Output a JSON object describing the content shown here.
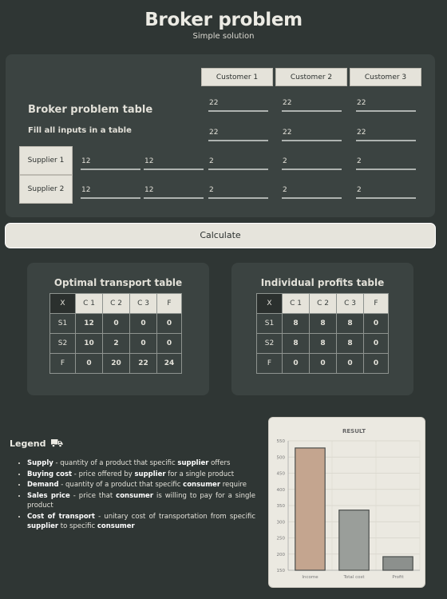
{
  "header": {
    "title": "Broker problem",
    "subtitle": "Simple solution"
  },
  "input": {
    "title": "Broker problem table",
    "hint": "Fill all inputs in a table",
    "customers": [
      "Customer 1",
      "Customer 2",
      "Customer 3"
    ],
    "demand": [
      "22",
      "22",
      "22"
    ],
    "sales_price": [
      "22",
      "22",
      "22"
    ],
    "suppliers": [
      {
        "label": "Supplier 1",
        "supply": "12",
        "cost": "12",
        "transport": [
          "2",
          "2",
          "2"
        ]
      },
      {
        "label": "Supplier 2",
        "supply": "12",
        "cost": "12",
        "transport": [
          "2",
          "2",
          "2"
        ]
      }
    ]
  },
  "calculate_label": "Calculate",
  "transport_table": {
    "title": "Optimal transport table",
    "headers": [
      "X",
      "C 1",
      "C 2",
      "C 3",
      "F"
    ],
    "rows": [
      {
        "label": "S1",
        "values": [
          "12",
          "0",
          "0",
          "0"
        ]
      },
      {
        "label": "S2",
        "values": [
          "10",
          "2",
          "0",
          "0"
        ]
      },
      {
        "label": "F",
        "values": [
          "0",
          "20",
          "22",
          "24"
        ]
      }
    ]
  },
  "profits_table": {
    "title": "Individual profits table",
    "headers": [
      "X",
      "C 1",
      "C 2",
      "C 3",
      "F"
    ],
    "rows": [
      {
        "label": "S1",
        "values": [
          "8",
          "8",
          "8",
          "0"
        ]
      },
      {
        "label": "S2",
        "values": [
          "8",
          "8",
          "8",
          "0"
        ]
      },
      {
        "label": "F",
        "values": [
          "0",
          "0",
          "0",
          "0"
        ]
      }
    ]
  },
  "legend": {
    "title": "Legend",
    "icon": "truck-icon",
    "items": [
      [
        {
          "t": "Supply",
          "b": true
        },
        {
          "t": " - quantity of a product that specific "
        },
        {
          "t": "supplier",
          "b": true
        },
        {
          "t": " offers"
        }
      ],
      [
        {
          "t": "Buying cost",
          "b": true
        },
        {
          "t": " - price offered by "
        },
        {
          "t": "supplier",
          "b": true
        },
        {
          "t": " for a single product"
        }
      ],
      [
        {
          "t": "Demand",
          "b": true
        },
        {
          "t": " - quantity of a product that specific "
        },
        {
          "t": "consumer",
          "b": true
        },
        {
          "t": " require"
        }
      ],
      [
        {
          "t": "Sales price",
          "b": true
        },
        {
          "t": " - price that "
        },
        {
          "t": "consumer",
          "b": true
        },
        {
          "t": " is willing to pay for a single product"
        }
      ],
      [
        {
          "t": "Cost of transport",
          "b": true
        },
        {
          "t": " - unitary cost of transportation from specific "
        },
        {
          "t": "supplier",
          "b": true
        },
        {
          "t": " to specific "
        },
        {
          "t": "consumer",
          "b": true
        }
      ]
    ]
  },
  "chart_data": {
    "type": "bar",
    "title": "RESULT",
    "categories": [
      "Income",
      "Total cost",
      "Profit"
    ],
    "values": [
      528,
      336,
      192
    ],
    "ylim": [
      150,
      550
    ],
    "yticks": [
      150,
      200,
      250,
      300,
      350,
      400,
      450,
      500,
      550
    ],
    "grid": true,
    "colors": [
      "#c4a58f",
      "#9a9e9a",
      "#8c908d"
    ],
    "border_color": "#4a4e4c"
  }
}
